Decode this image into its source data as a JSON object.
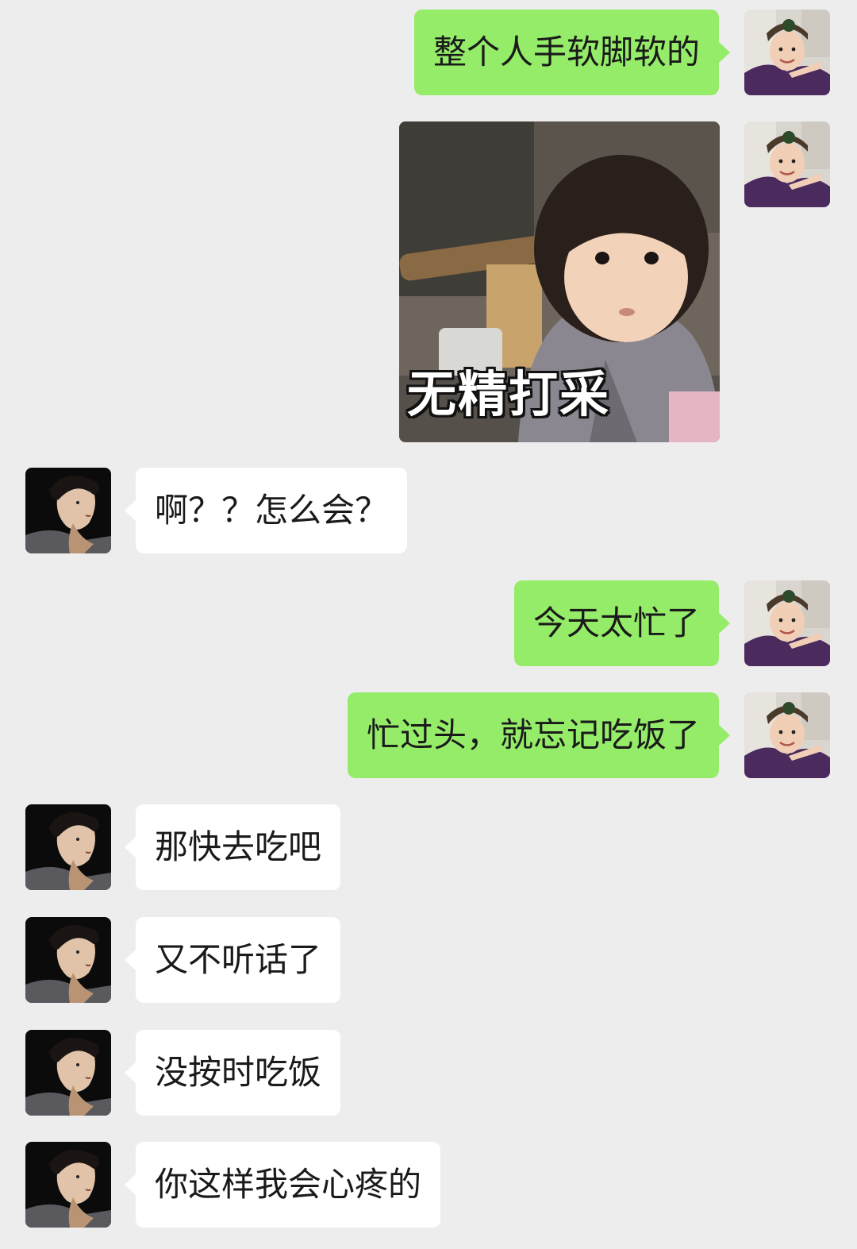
{
  "chat": {
    "messages": [
      {
        "from": "me",
        "type": "text",
        "text": "整个人手软脚软的"
      },
      {
        "from": "me",
        "type": "sticker",
        "caption": "无精打采"
      },
      {
        "from": "them",
        "type": "text",
        "text": "啊？？怎么会？"
      },
      {
        "from": "me",
        "type": "text",
        "text": "今天太忙了"
      },
      {
        "from": "me",
        "type": "text",
        "text": "忙过头，就忘记吃饭了"
      },
      {
        "from": "them",
        "type": "text",
        "text": "那快去吃吧"
      },
      {
        "from": "them",
        "type": "text",
        "text": "又不听话了"
      },
      {
        "from": "them",
        "type": "text",
        "text": "没按时吃饭"
      },
      {
        "from": "them",
        "type": "text",
        "text": "你这样我会心疼的"
      }
    ]
  },
  "colors": {
    "background": "#ededed",
    "sent_bubble": "#95ec69",
    "received_bubble": "#ffffff",
    "text": "#1a1a1a"
  },
  "icons": {
    "me_avatar": "avatar-girl-photo",
    "them_avatar": "avatar-man-photo"
  }
}
